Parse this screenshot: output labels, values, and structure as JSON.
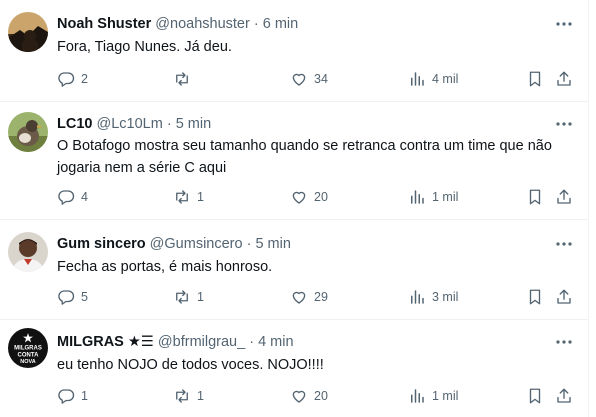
{
  "colors": {
    "text": "#0f1419",
    "muted": "#536471",
    "divider": "#eff3f4"
  },
  "tweets": [
    {
      "name": "Noah Shuster",
      "badge": "",
      "handle": "@noahshuster",
      "dot": "·",
      "time": "6 min",
      "text": [
        "Fora, Tiago Nunes. Já deu."
      ],
      "replies": "2",
      "retweets": "",
      "likes": "34",
      "views": "4 mil",
      "avatar_icon": "profile-photo-silhouette"
    },
    {
      "name": "LC10",
      "badge": "",
      "handle": "@Lc10Lm",
      "dot": "·",
      "time": "5 min",
      "text": [
        "O Botafogo mostra seu tamanho quando se retranca contra um time que não",
        "jogaria nem a série C aqui"
      ],
      "replies": "4",
      "retweets": "1",
      "likes": "20",
      "views": "1 mil",
      "avatar_icon": "profile-photo-bird"
    },
    {
      "name": "Gum sincero",
      "badge": "",
      "handle": "@Gumsincero",
      "dot": "·",
      "time": "5 min",
      "text": [
        "Fecha as portas, é mais honroso."
      ],
      "replies": "5",
      "retweets": "1",
      "likes": "29",
      "views": "3 mil",
      "avatar_icon": "profile-photo-player"
    },
    {
      "name": "MILGRAS",
      "badge": "★☰",
      "handle": "@bfrmilgrau_",
      "dot": "·",
      "time": "4 min",
      "text": [
        "eu tenho NOJO de todos voces. NOJO!!!!"
      ],
      "replies": "1",
      "retweets": "1",
      "likes": "20",
      "views": "1 mil",
      "avatar_icon": "milgras-logo",
      "avatar_text": "MILGRAS CONTA NOVA"
    }
  ]
}
